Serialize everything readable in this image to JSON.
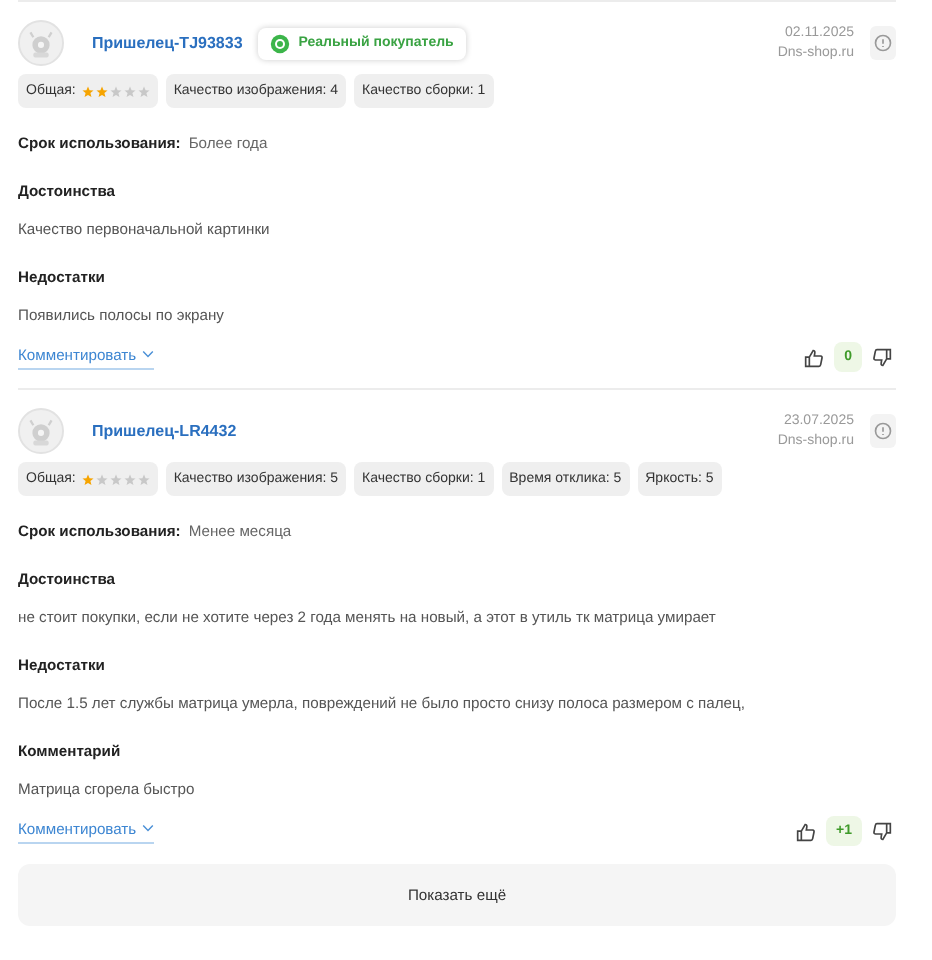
{
  "reviews": [
    {
      "author": "Пришелец-TJ93833",
      "badge": "Реальный покупатель",
      "date": "02.11.2025",
      "source": "Dns-shop.ru",
      "ratings": [
        {
          "kind": "stars",
          "label": "Общая:",
          "stars": 2
        },
        {
          "kind": "value",
          "label": "Качество изображения: 4"
        },
        {
          "kind": "value",
          "label": "Качество сборки: 1"
        }
      ],
      "usage_label": "Срок использования:",
      "usage_value": "Более года",
      "sections": [
        {
          "heading": "Достоинства",
          "text": "Качество первоначальной картинки"
        },
        {
          "heading": "Недостатки",
          "text": "Появились полосы по экрану"
        }
      ],
      "comment_link": "Комментировать",
      "votes": "0"
    },
    {
      "author": "Пришелец-LR4432",
      "date": "23.07.2025",
      "source": "Dns-shop.ru",
      "ratings": [
        {
          "kind": "stars",
          "label": "Общая:",
          "stars": 1
        },
        {
          "kind": "value",
          "label": "Качество изображения: 5"
        },
        {
          "kind": "value",
          "label": "Качество сборки: 1"
        },
        {
          "kind": "value",
          "label": "Время отклика: 5"
        },
        {
          "kind": "value",
          "label": "Яркость: 5"
        }
      ],
      "usage_label": "Срок использования:",
      "usage_value": "Менее месяца",
      "sections": [
        {
          "heading": "Достоинства",
          "text": "не стоит покупки, если не хотите через 2 года менять на новый, а этот в утиль тк матрица умирает"
        },
        {
          "heading": "Недостатки",
          "text": "После 1.5 лет службы матрица умерла, повреждений не было просто снизу полоса размером с палец,"
        },
        {
          "heading": "Комментарий",
          "text": "Матрица сгорела быстро"
        }
      ],
      "comment_link": "Комментировать",
      "votes": "+1"
    }
  ],
  "show_more": "Показать ещё"
}
